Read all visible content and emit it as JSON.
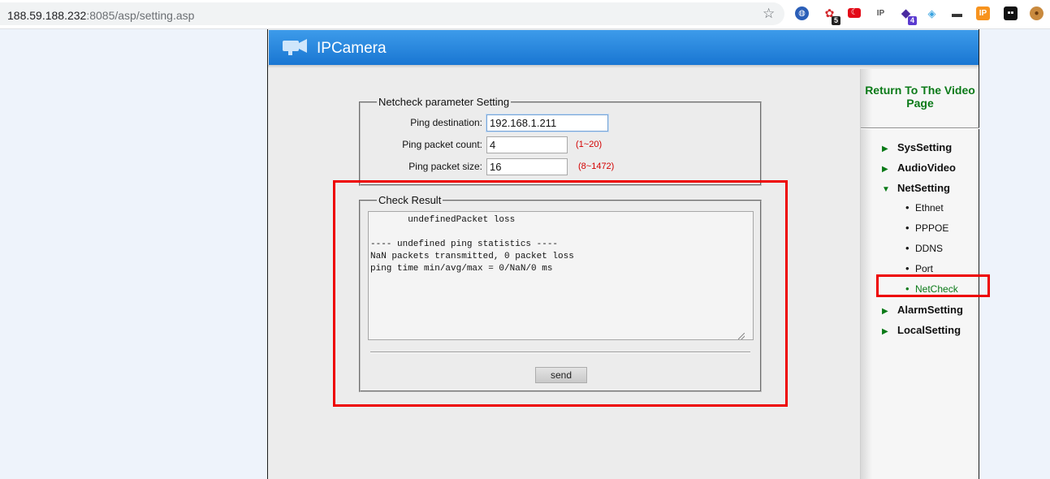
{
  "browser": {
    "url_host": "188.59.188.232",
    "url_rest": ":8085/asp/setting.asp",
    "extension_badges": [
      "5",
      "4"
    ],
    "extension_icons": [
      "globe-icon",
      "puzzle-icon",
      "flag-icon",
      "ip-search-icon",
      "cube-icon",
      "ring-icon",
      "mask-icon",
      "spy-icon",
      "ip-icon",
      "ghost-icon",
      "cookie-icon"
    ]
  },
  "app": {
    "brand": "IPCamera",
    "colors": {
      "header": "#1976d2",
      "nav_green": "#0b7a18",
      "range_red": "#d40000",
      "highlight": "#ee0000"
    }
  },
  "netcheck": {
    "legend": "Netcheck parameter Setting",
    "fields": [
      {
        "label": "Ping destination:",
        "value": "192.168.1.211",
        "range": ""
      },
      {
        "label": "Ping packet count:",
        "value": "4",
        "range": "(1~20)"
      },
      {
        "label": "Ping packet size:",
        "value": "16",
        "range": "(8~1472)"
      }
    ]
  },
  "check_result": {
    "legend": "Check Result",
    "text": "       undefinedPacket loss\n\n---- undefined ping statistics ----\nNaN packets transmitted, 0 packet loss\nping time min/avg/max = 0/NaN/0 ms",
    "send_label": "send"
  },
  "nav": {
    "return_label": "Return To The Video Page",
    "items": [
      {
        "label": "SysSetting",
        "expanded": false
      },
      {
        "label": "AudioVideo",
        "expanded": false
      },
      {
        "label": "NetSetting",
        "expanded": true
      },
      {
        "label": "AlarmSetting",
        "expanded": false
      },
      {
        "label": "LocalSetting",
        "expanded": false
      }
    ],
    "netsetting_subitems": [
      "Ethnet",
      "PPPOE",
      "DDNS",
      "Port",
      "NetCheck"
    ],
    "active_subitem": "NetCheck"
  }
}
